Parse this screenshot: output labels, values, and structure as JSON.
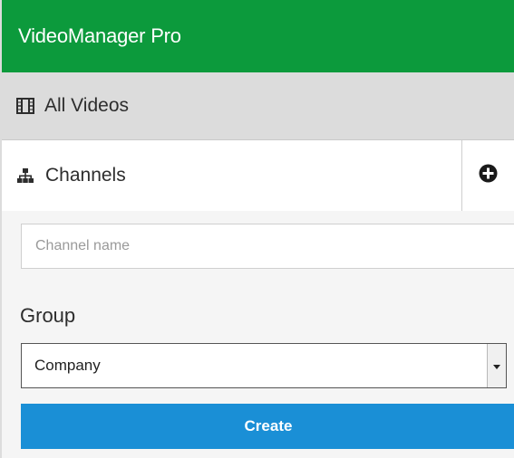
{
  "header": {
    "app_title": "VideoManager Pro",
    "color": "#0c9a3c"
  },
  "nav": {
    "all_videos": {
      "label": "All Videos",
      "icon": "film-icon"
    },
    "channels": {
      "label": "Channels",
      "icon": "sitemap-icon",
      "add_icon": "plus-circle-icon"
    }
  },
  "channel_form": {
    "name_input": {
      "placeholder": "Channel name",
      "value": ""
    },
    "group_label": "Group",
    "group_select": {
      "selected": "Company",
      "arrow_icon": "caret-down-icon"
    },
    "create_label": "Create",
    "create_color": "#1a8fd6"
  }
}
